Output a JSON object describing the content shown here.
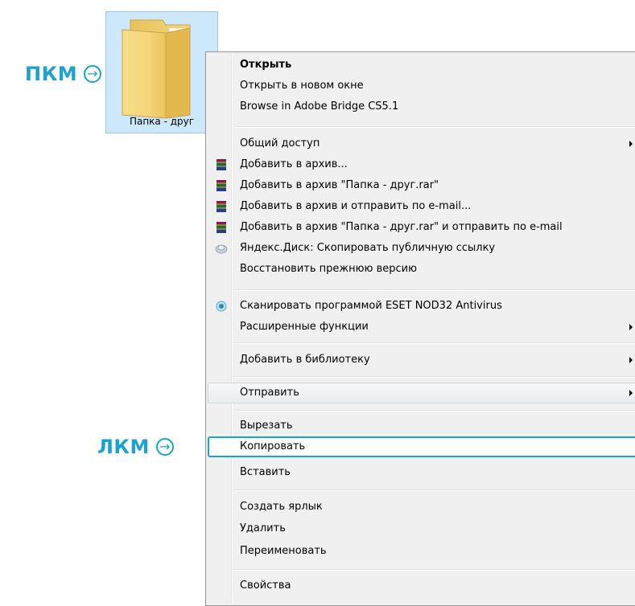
{
  "annotations": {
    "right_click": "ПКМ",
    "left_click": "ЛКМ",
    "accent_color": "#1aa3d1"
  },
  "folder": {
    "label": "Папка - друг",
    "icon": "folder-icon"
  },
  "menu": {
    "open": "Открыть",
    "open_new_window": "Открыть в новом окне",
    "browse_bridge": "Browse in Adobe Bridge CS5.1",
    "sharing": "Общий доступ",
    "add_archive": "Добавить в архив...",
    "add_archive_named": "Добавить в архив \"Папка - друг.rar\"",
    "add_archive_email": "Добавить в архив и отправить по e-mail...",
    "add_archive_named_email": "Добавить в архив \"Папка - друг.rar\" и отправить по e-mail",
    "yandex_disk": "Яндекс.Диск: Скопировать публичную ссылку",
    "restore_prev": "Восстановить прежнюю версию",
    "eset_scan": "Сканировать программой ESET NOD32 Antivirus",
    "advanced": "Расширенные функции",
    "add_library": "Добавить в библиотеку",
    "send_to": "Отправить",
    "cut": "Вырезать",
    "copy": "Копировать",
    "paste": "Вставить",
    "create_shortcut": "Создать ярлык",
    "delete": "Удалить",
    "rename": "Переименовать",
    "properties": "Свойства"
  }
}
